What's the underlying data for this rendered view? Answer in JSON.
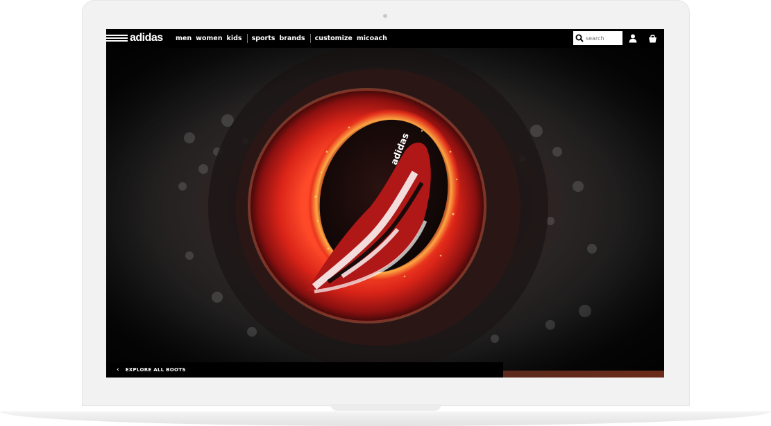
{
  "brand": {
    "logo_text": "adidas"
  },
  "nav": {
    "items": [
      {
        "label": "men"
      },
      {
        "label": "women"
      },
      {
        "label": "kids"
      },
      {
        "label": "sports"
      },
      {
        "label": "brands"
      },
      {
        "label": "customize"
      },
      {
        "label": "micoach"
      }
    ]
  },
  "search": {
    "placeholder": "search"
  },
  "icons": {
    "search": "search-icon",
    "account": "user-icon",
    "cart": "shopping-bag-icon",
    "back": "chevron-left-icon"
  },
  "hero": {
    "boot_text": "adidas"
  },
  "explore": {
    "chevron": "‹",
    "label": "EXPLORE ALL BOOTS"
  },
  "colors": {
    "nav_bg": "#000000",
    "accent_red": "#d42a1c",
    "glow": "#ff6a2a"
  }
}
